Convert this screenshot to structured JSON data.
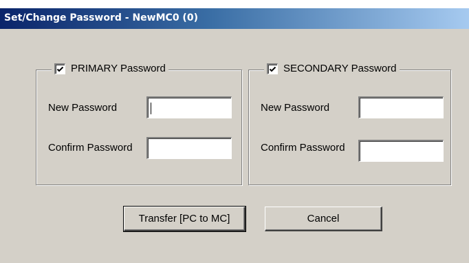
{
  "window": {
    "title": "Set/Change Password - NewMC0 (0)"
  },
  "primary": {
    "checkbox_label": "PRIMARY Password",
    "checked": true,
    "new_password_label": "New Password",
    "new_password_value": "",
    "confirm_password_label": "Confirm Password",
    "confirm_password_value": ""
  },
  "secondary": {
    "checkbox_label": "SECONDARY Password",
    "checked": true,
    "new_password_label": "New Password",
    "new_password_value": "",
    "confirm_password_label": "Confirm Password",
    "confirm_password_value": ""
  },
  "buttons": {
    "transfer_label": "Transfer [PC to MC]",
    "cancel_label": "Cancel"
  },
  "colors": {
    "titlebar_start": "#0a246a",
    "titlebar_end": "#a6caf0",
    "dialog_background": "#d4d0c8"
  },
  "icons": {
    "checkmark": "checkmark-icon"
  }
}
